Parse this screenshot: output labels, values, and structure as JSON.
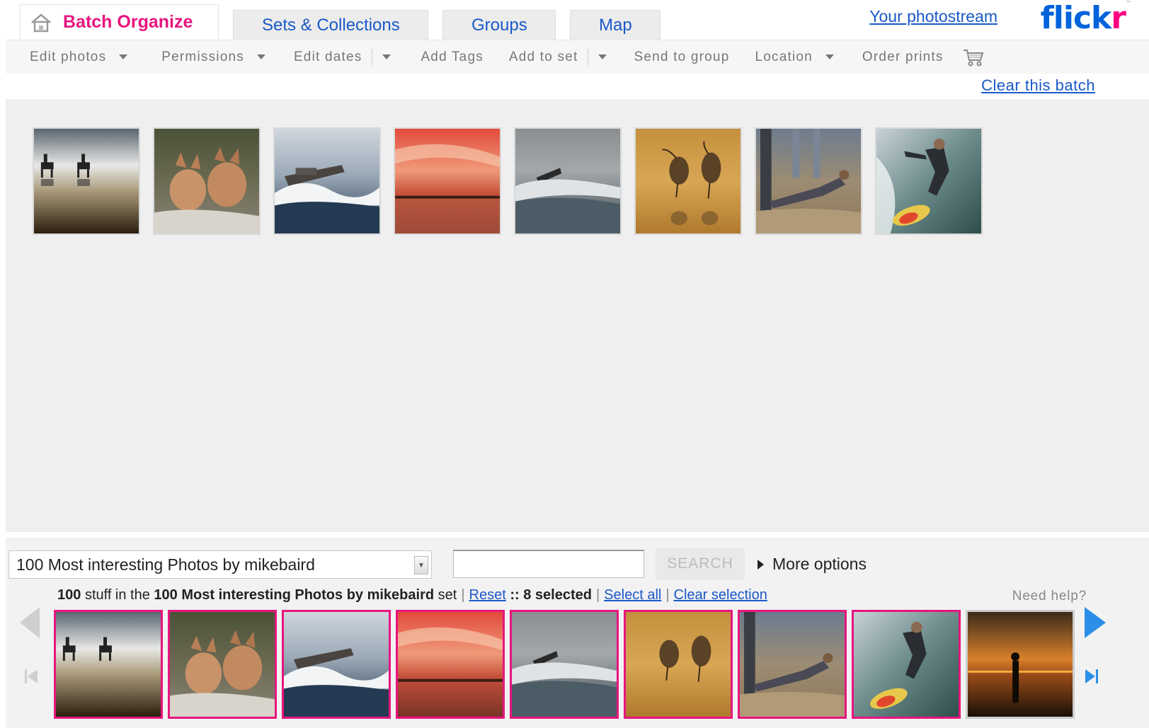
{
  "header": {
    "tabs": [
      {
        "label": "Batch Organize",
        "active": true
      },
      {
        "label": "Sets & Collections"
      },
      {
        "label": "Groups"
      },
      {
        "label": "Map"
      }
    ],
    "photostream_link": "Your photostream",
    "logo": {
      "part1": "flick",
      "part2": "r",
      "tm": "™"
    }
  },
  "toolbar": {
    "items": [
      {
        "label": "Edit photos"
      },
      {
        "label": "Permissions"
      },
      {
        "label": "Edit dates"
      },
      {
        "label": "Add Tags"
      },
      {
        "label": "Add to set"
      },
      {
        "label": "Send to group"
      },
      {
        "label": "Location"
      },
      {
        "label": "Order prints"
      }
    ],
    "clear_batch": "Clear this batch"
  },
  "batch": {
    "photos": [
      {
        "subject": "horse-riders-reflection"
      },
      {
        "subject": "fox-kits"
      },
      {
        "subject": "boat-wave"
      },
      {
        "subject": "red-sunset-sea"
      },
      {
        "subject": "boat-grey-sea"
      },
      {
        "subject": "shorebirds-sand"
      },
      {
        "subject": "beach-pushup"
      },
      {
        "subject": "surfer"
      }
    ]
  },
  "organizer": {
    "set_select": {
      "value": "100 Most interesting Photos by mikebaird"
    },
    "search": {
      "value": "",
      "button_label": "SEARCH"
    },
    "more_options": "More options",
    "status": {
      "count": "100",
      "text1": "stuff in the",
      "set_name": "100 Most interesting Photos by mikebaird",
      "text2": "set",
      "reset": "Reset",
      "separator": "::",
      "selected": "8 selected",
      "select_all": "Select all",
      "clear_selection": "Clear selection"
    },
    "need_help": "Need help?",
    "strip": [
      {
        "subject": "horse-riders-reflection",
        "selected": true
      },
      {
        "subject": "fox-kits",
        "selected": true
      },
      {
        "subject": "boat-wave",
        "selected": true
      },
      {
        "subject": "red-sunset-sea",
        "selected": true
      },
      {
        "subject": "boat-grey-sea",
        "selected": true
      },
      {
        "subject": "shorebirds-sand",
        "selected": true
      },
      {
        "subject": "beach-pushup",
        "selected": true
      },
      {
        "subject": "surfer",
        "selected": true
      },
      {
        "subject": "silhouette-sunset",
        "selected": false
      }
    ]
  },
  "colors": {
    "brand_pink": "#e8157e",
    "link_blue": "#1a59c9",
    "flickr_blue": "#0063dc",
    "flickr_pink": "#ff0084",
    "nav_arrow_blue": "#2b8fe8"
  }
}
